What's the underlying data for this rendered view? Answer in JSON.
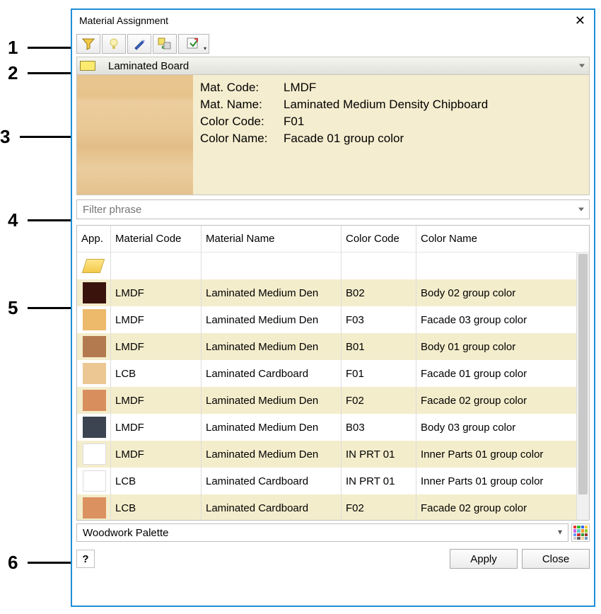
{
  "window": {
    "title": "Material Assignment"
  },
  "category": {
    "label": "Laminated Board"
  },
  "preview": {
    "mat_code_label": "Mat. Code:",
    "mat_code": "LMDF",
    "mat_name_label": "Mat. Name:",
    "mat_name": "Laminated Medium Density Chipboard",
    "color_code_label": "Color Code:",
    "color_code": "F01",
    "color_name_label": "Color Name:",
    "color_name": "Facade 01 group color"
  },
  "filter": {
    "placeholder": "Filter phrase"
  },
  "table": {
    "headers": {
      "app": "App.",
      "mat_code": "Material Code",
      "mat_name": "Material Name",
      "color_code": "Color Code",
      "color_name": "Color Name"
    },
    "rows": [
      {
        "swatch": "#3a140c",
        "mat_code": "LMDF",
        "mat_name": "Laminated Medium Den",
        "color_code": "B02",
        "color_name": "Body 02 group color"
      },
      {
        "swatch": "#edb96a",
        "mat_code": "LMDF",
        "mat_name": "Laminated Medium Den",
        "color_code": "F03",
        "color_name": "Facade 03 group color"
      },
      {
        "swatch": "#b47a4f",
        "mat_code": "LMDF",
        "mat_name": "Laminated Medium Den",
        "color_code": "B01",
        "color_name": "Body 01 group color"
      },
      {
        "swatch": "#ecc794",
        "mat_code": "LCB",
        "mat_name": "Laminated Cardboard",
        "color_code": "F01",
        "color_name": "Facade 01 group color"
      },
      {
        "swatch": "#d98e5e",
        "mat_code": "LMDF",
        "mat_name": "Laminated Medium Den",
        "color_code": "F02",
        "color_name": "Facade 02 group color"
      },
      {
        "swatch": "#3b4450",
        "mat_code": "LMDF",
        "mat_name": "Laminated Medium Den",
        "color_code": "B03",
        "color_name": "Body 03 group color"
      },
      {
        "swatch": "#ffffff",
        "mat_code": "LMDF",
        "mat_name": "Laminated Medium Den",
        "color_code": "IN PRT 01",
        "color_name": "Inner Parts 01 group color"
      },
      {
        "swatch": "#ffffff",
        "mat_code": "LCB",
        "mat_name": "Laminated Cardboard",
        "color_code": "IN PRT 01",
        "color_name": "Inner Parts 01 group color"
      },
      {
        "swatch": "#dc9160",
        "mat_code": "LCB",
        "mat_name": "Laminated Cardboard",
        "color_code": "F02",
        "color_name": "Facade 02 group color"
      }
    ],
    "cut_row_swatch": "#3a140c"
  },
  "palette": {
    "label": "Woodwork Palette"
  },
  "buttons": {
    "apply": "Apply",
    "close": "Close"
  },
  "callouts": {
    "c1": "1",
    "c2": "2",
    "c3": "3",
    "c4": "4",
    "c5": "5",
    "c6": "6"
  }
}
